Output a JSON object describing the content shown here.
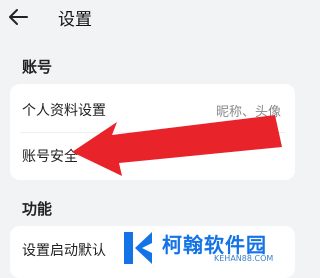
{
  "header": {
    "title": "设置"
  },
  "sections": {
    "account": {
      "label": "账号",
      "rows": [
        {
          "label": "个人资料设置",
          "value": "昵称、头像"
        },
        {
          "label": "账号安全",
          "value": ""
        }
      ]
    },
    "features": {
      "label": "功能",
      "rows": [
        {
          "label": "设置启动默认",
          "value": ""
        }
      ]
    }
  },
  "annotation": {
    "color": "#e8242a"
  },
  "watermark": {
    "name": "柯翰软件园",
    "url": "KEHAN88.COM",
    "color": "#1473e6"
  }
}
